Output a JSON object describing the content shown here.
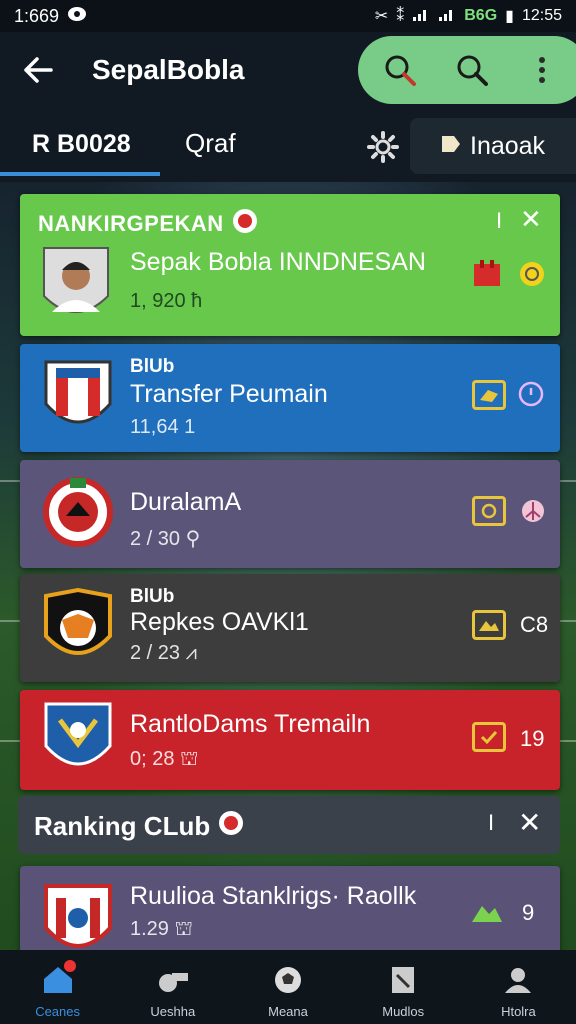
{
  "status_bar": {
    "time": "1:669",
    "battery_text": "B6G",
    "clock": "12:55"
  },
  "app_bar": {
    "title": "SepalBobla"
  },
  "tabs": {
    "tab1": "R B0028",
    "tab2": "Qraf",
    "tab3": "Inaoak"
  },
  "cards": [
    {
      "header": "NANKIRGPEKAN",
      "name": "Sepak Bobla INNDNESAN",
      "meta": "1, 920 ħ",
      "color": "#67c84b"
    },
    {
      "kicker": "BlUb",
      "name": "Transfer Peumain",
      "meta": "11,64 1",
      "color": "#1f6fbd"
    },
    {
      "name": "DuralamA",
      "meta": "2 / 30 ⚲",
      "color": "#5c557a"
    },
    {
      "kicker": "BlUb",
      "name": "Repkes OAVKl1",
      "meta": "2 / 23 ⩘",
      "trail": "C8",
      "color": "#3d3d3d"
    },
    {
      "name": "RantloDams Tremailn",
      "meta": "0; 28 ⛫",
      "trail": "19",
      "color": "#c8232a"
    }
  ],
  "section": {
    "title": "Ranking CLub"
  },
  "ranking_item": {
    "name": "Ruulioa Stanklrigs· Raollk",
    "meta": "1.29 ⛫",
    "trail": "9"
  },
  "bottom_nav": [
    {
      "label": "Ceanes",
      "icon": "home-icon",
      "active": true
    },
    {
      "label": "Ueshha",
      "icon": "whistle-icon",
      "active": false
    },
    {
      "label": "Meana",
      "icon": "soccer-ball-icon",
      "active": false
    },
    {
      "label": "Mudlos",
      "icon": "document-icon",
      "active": false
    },
    {
      "label": "Htolra",
      "icon": "group-icon",
      "active": false
    }
  ]
}
